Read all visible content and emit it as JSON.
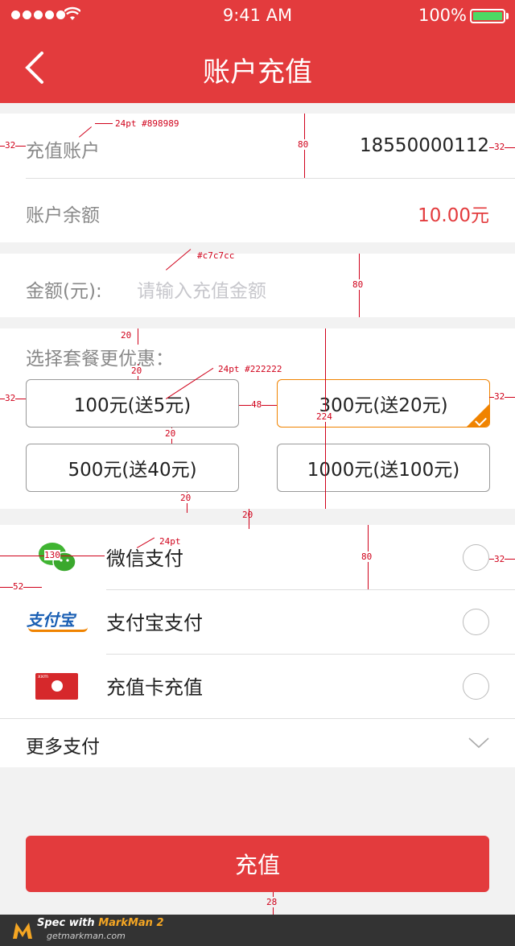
{
  "status_bar": {
    "time": "9:41 AM",
    "battery": "100%"
  },
  "nav": {
    "title": "账户充值"
  },
  "account": {
    "recharge_label": "充值账户",
    "recharge_value": "18550000112",
    "balance_label": "账户余额",
    "balance_value": "10.00元"
  },
  "amount": {
    "label": "金额(元):",
    "placeholder": "请输入充值金额"
  },
  "packages": {
    "title": "选择套餐更优惠：",
    "items": [
      {
        "label": "100元(送5元)",
        "selected": false
      },
      {
        "label": "300元(送20元)",
        "selected": true
      },
      {
        "label": "500元(送40元)",
        "selected": false
      },
      {
        "label": "1000元(送100元)",
        "selected": false
      }
    ]
  },
  "payment": {
    "options": [
      {
        "label": "微信支付",
        "icon": "wechat-icon"
      },
      {
        "label": "支付宝支付",
        "icon": "alipay-icon",
        "logo_text": "支付宝"
      },
      {
        "label": "充值卡充值",
        "icon": "recharge-card-icon",
        "logo_text": "xxm"
      }
    ],
    "more_label": "更多支付"
  },
  "submit_label": "充值",
  "footer": {
    "brand_prefix": "Spec with ",
    "brand": "MarkMan 2",
    "site": "getmarkman.com"
  },
  "annotations": {
    "a1": "24pt #898989",
    "a2": "32",
    "a3": "32",
    "a4": "80",
    "a5": "#c7c7cc",
    "a6": "80",
    "a7": "20",
    "a8": "20",
    "a9": "24pt #222222",
    "a10": "32",
    "a11": "48",
    "a12": "32",
    "a13": "20",
    "a14": "224",
    "a15": "20",
    "a16": "20",
    "a17": "24pt",
    "a18": "130",
    "a19": "80",
    "a20": "32",
    "a21": "52",
    "a22": "28"
  },
  "colors": {
    "brand_red": "#e33b3d",
    "accent_orange": "#f08300",
    "label_gray": "#898989",
    "placeholder": "#c7c7cc"
  }
}
